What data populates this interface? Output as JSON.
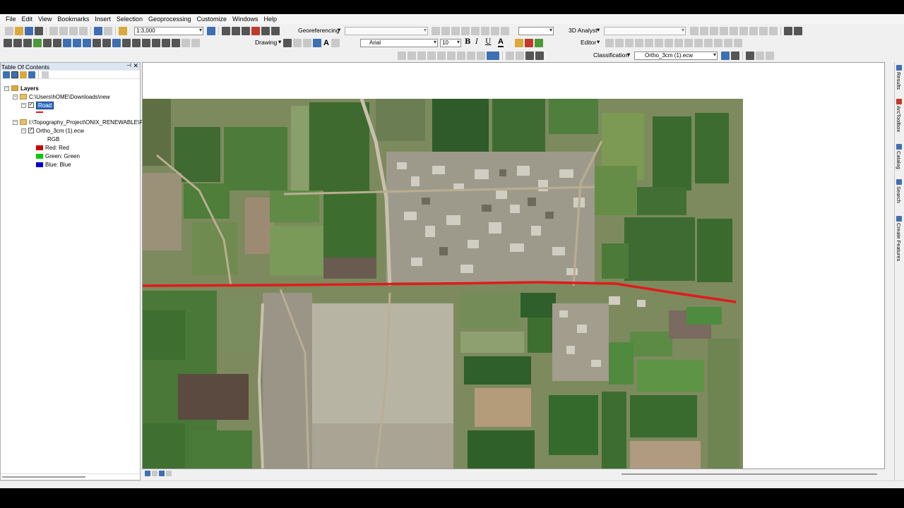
{
  "menubar": {
    "items": [
      "File",
      "Edit",
      "View",
      "Bookmarks",
      "Insert",
      "Selection",
      "Geoprocessing",
      "Customize",
      "Windows",
      "Help"
    ]
  },
  "toolbar": {
    "scale": "1:3,000",
    "georeferencing_label": "Georeferencing",
    "analyst_label": "3D Analyst",
    "drawing_label": "Drawing",
    "font_name": "Arial",
    "font_size": "10",
    "bold": "B",
    "italic": "I",
    "underline": "U",
    "font_color_glyph": "A",
    "editor_label": "Editor",
    "classification_label": "Classification",
    "raster_layer": "Ortho_3cm (1).ecw",
    "text_tool_glyph": "A"
  },
  "toc": {
    "title": "Table Of Contents",
    "layers_label": "Layers",
    "group1_path": "C:\\Users\\hOME\\Downloads\\new",
    "road_layer": "Road",
    "road_color": "#d7191c",
    "group2_path": "I:\\Topography_Project\\ONIX_RENEWABLE\\P",
    "raster_layer": "Ortho_3cm (1).ecw",
    "rgb_label": "RGB",
    "bands": [
      {
        "label": "Red:   Red",
        "color": "#cc0000"
      },
      {
        "label": "Green: Green",
        "color": "#00cc00"
      },
      {
        "label": "Blue:  Blue",
        "color": "#0000cc"
      }
    ]
  },
  "right_dock": {
    "tabs": [
      "Results",
      "ArcToolbox",
      "Catalog",
      "Search",
      "Create Features"
    ]
  },
  "map": {
    "road_color": "#e31a1c"
  }
}
